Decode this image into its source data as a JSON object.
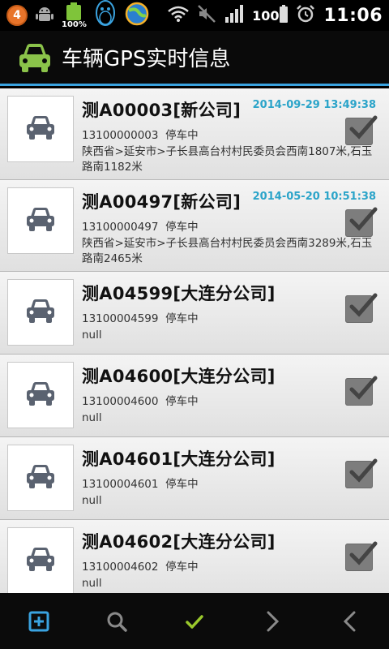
{
  "status_bar": {
    "notification_count": "4",
    "battery_small_label": "100%",
    "battery_level": "100",
    "time": "11:06",
    "icons": [
      "notification-badge-icon",
      "android-icon",
      "battery-charging-icon",
      "qq-penguin-icon",
      "browser-globe-icon",
      "wifi-icon",
      "mute-icon",
      "signal-icon",
      "battery-icon",
      "alarm-icon"
    ]
  },
  "app_bar": {
    "title": "车辆GPS实时信息",
    "icon": "car-icon",
    "accent_color": "#3aa3e0"
  },
  "vehicles": [
    {
      "plate": "测A00003[新公司]",
      "time": "2014-09-29 13:49:38",
      "phone": "13100000003",
      "status": "停车中",
      "address": "陕西省>延安市>子长县高台村村民委员会西南1807米,石玉路南1182米"
    },
    {
      "plate": "测A00497[新公司]",
      "time": "2014-05-20 10:51:38",
      "phone": "13100000497",
      "status": "停车中",
      "address": "陕西省>延安市>子长县高台村村民委员会西南3289米,石玉路南2465米"
    },
    {
      "plate": "测A04599[大连分公司]",
      "time": "",
      "phone": "13100004599",
      "status": "停车中",
      "address": "null"
    },
    {
      "plate": "测A04600[大连分公司]",
      "time": "",
      "phone": "13100004600",
      "status": "停车中",
      "address": "null"
    },
    {
      "plate": "测A04601[大连分公司]",
      "time": "",
      "phone": "13100004601",
      "status": "停车中",
      "address": "null"
    },
    {
      "plate": "测A04602[大连分公司]",
      "time": "",
      "phone": "13100004602",
      "status": "停车中",
      "address": "null"
    }
  ],
  "bottom_nav": [
    {
      "name": "add",
      "icon": "add-icon",
      "color": "#3aa3e0"
    },
    {
      "name": "search",
      "icon": "search-icon",
      "color": "#8a8a8a"
    },
    {
      "name": "confirm",
      "icon": "check-icon",
      "color": "#9ac92c"
    },
    {
      "name": "next",
      "icon": "chevron-right-icon",
      "color": "#8a8a8a"
    },
    {
      "name": "back",
      "icon": "chevron-left-icon",
      "color": "#8a8a8a"
    }
  ]
}
